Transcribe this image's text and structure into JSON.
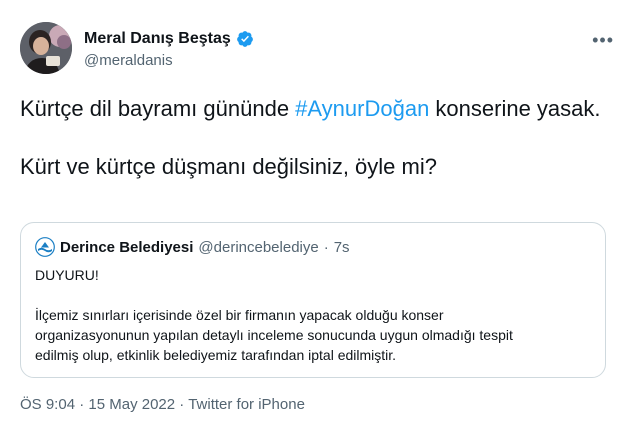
{
  "author": {
    "name": "Meral Danış Beştaş",
    "handle": "@meraldanis",
    "verified_color": "#1d9bf0"
  },
  "tweet": {
    "line1_before": "Kürtçe dil bayramı gününde ",
    "hashtag": "#AynurDoğan",
    "line1_after": " konserine yasak.",
    "line2": "Kürt ve kürtçe düşmanı değilsiniz, öyle mi?"
  },
  "quoted": {
    "name": "Derince Belediyesi",
    "handle": "@derincebelediye",
    "separator": "·",
    "time": "7s",
    "title": "DUYURU!",
    "body_lines": [
      "İlçemiz sınırları içerisinde özel bir firmanın yapacak olduğu konser",
      "organizasyonunun yapılan detaylı inceleme sonucunda uygun olmadığı tespit",
      "edilmiş olup, etkinlik belediyemiz tarafından iptal edilmiştir."
    ]
  },
  "footer": {
    "time": "ÖS 9:04",
    "sep1": " · ",
    "date": "15 May 2022",
    "sep2": " · ",
    "source": "Twitter for iPhone"
  },
  "icons": {
    "more": "more-icon",
    "verified": "verified-badge-icon",
    "logo": "municipality-logo-icon"
  },
  "colors": {
    "link": "#1d9bf0",
    "secondary_text": "#536471",
    "border": "#cfd9de"
  }
}
